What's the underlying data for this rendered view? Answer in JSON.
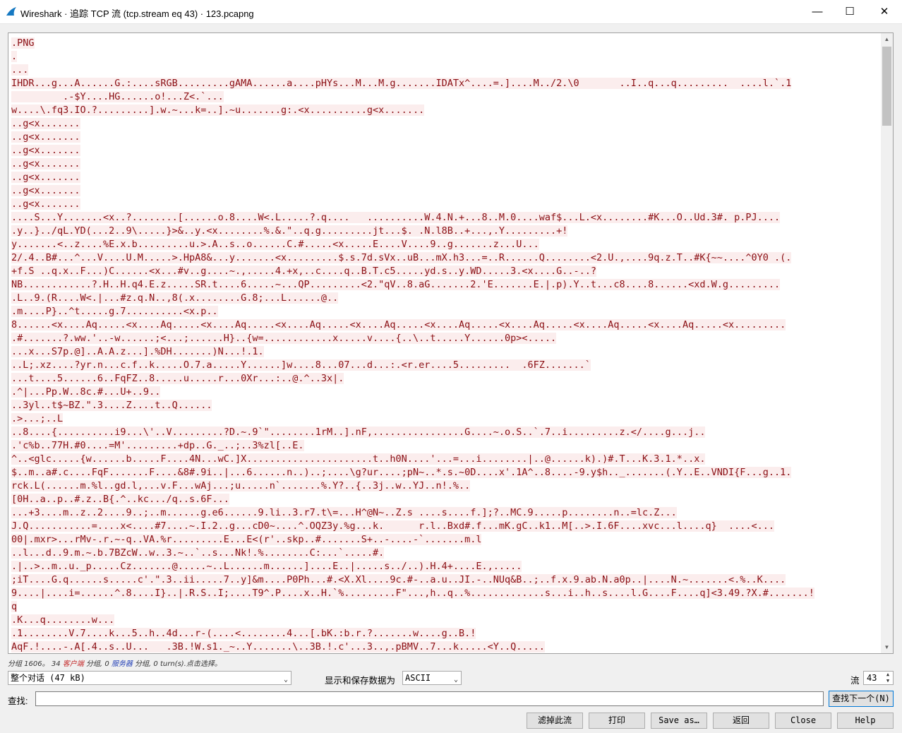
{
  "window": {
    "title": "Wireshark · 追踪 TCP 流 (tcp.stream eq 43) · 123.pcapng",
    "minimize_glyph": "—",
    "maximize_glyph": "☐",
    "close_glyph": "✕"
  },
  "stream": {
    "text_color": "#8b0f14",
    "highlight_color": "#fbeded",
    "lines": [
      ".PNG",
      ".",
      "...",
      "IHDR...g...A......G.:....sRGB.........gAMA......a....pHYs...M...M.g.......IDATx^....=.]....M../2.\\0       ..I..q...q.........  ....l.`.1",
      "         .-$Y....HG......o!...Z<.`...",
      "w....\\.fq3.IO.?.........].w.~...k=..].~u.......g:.<x..........g<x.......",
      "..g<x.......",
      "..g<x.......",
      "..g<x.......",
      "..g<x.......",
      "..g<x.......",
      "..g<x.......",
      "..g<x.......",
      "....S...Y.......<x..?........[......o.8....W<.L.....?.q....   ..........W.4.N.+...8..M.0....waf$...L.<x........#K...O..Ud.3#. p.PJ....",
      ".y..}../qL.YD(...2..9\\.....}>&..y.<x........%.&.\"..q.g.........jt...$. .N.l8B..+...,.Y.........+!",
      "y.......<..z....%E.x.b.........u.>.A..s..o......C.#.....<x.....E....V....9..g.......z...U...",
      "2/.4..B#...^...V....U.M.....>.HpA8&...y.......<x.........$.s.7d.sVx..uB...mX.h3...=..R......Q........<2.U.,....9q.z.T..#K{~~....^0Y0 .(.",
      "+f.S ..q.x..F...)C......<x...#v..g....~.,.....4.+x,..c....q..B.T.c5.....yd.s..y.WD.....3.<x....G..-..?",
      "NB............?.H..H.q4.E.z.....SR.t....6.....~...QP.........<2.\"qV..8.aG.......2.'E.......E.|.p).Y..t...c8....8......<xd.W.g.........",
      ".L..9.(R....W<.|...#z.q.N..,8(.x........G.8;...L......@..",
      ".m....P}..^t.....g.7..........<x.p..",
      "8......<x....Aq.....<x....Aq.....<x....Aq.....<x....Aq.....<x....Aq.....<x....Aq.....<x....Aq.....<x....Aq.....<x....Aq.....<x.........",
      ".#.......?.ww.'..-w......;<...;......H}..{w=............x.....v....{..\\..t.....Y......0p><.....",
      "...x...S7p.@]..A.A.z...].%DH.......)N...!.1.",
      "..L;.xz....?yr.n...c.f..k.....O.7.a.....Y......]w....8...07...d...:.<r.er....5.........  .6FZ.......`",
      "...t....5......6..FqFZ..8.....u.....r...0Xr...:..@.^..3x|.",
      ".^|...Pp.W..8c.#...U+..9..",
      "..3yl..t$~BZ.\".3....Z....t..Q......",
      ".>...;..L",
      "..8....{..........i9...\\'..V.........?D.~.9`\"........1rM..].nF,................G....~.o.S..`.7..i.........z.</....g...j..",
      ".'c%b..77H.#0....=M'.........+dp..G._..;..3%zl[..E.",
      "^..<glc.....{w......b.....F....4N...wC.]X......................t..h0N....'...=...i........|..@......k).)#.T...K.3.1.*..x.",
      "$..m..a#.c....FqF.......F....&8#.9i..|...6......n..)..;....\\g?ur....;pN~..*.s.~0D....x'.1A^..8....-9.y$h.._.......(.Y..E..VNDI{F...g..1.",
      "rck.L(......m.%l..gd.l,...v.F...wAj...;u.....n`.......%.Y?..{..3j..w..YJ..n!.%..",
      "[0H..a..p..#.z..B{.^..kc.../q..s.6F...",
      "...+3....m..z..2....9..;..m......g.e6......9.li..3.r7.t\\=...H^@N~..Z.s ....s....f.];?..MC.9.....p........n..=lc.Z...",
      "J.Q...........=....x<....#7....~.I.2..g...cD0~....^.OQZ3y.%g...k.      r.l..Bxd#.f...mK.gC..k1..M[..>.I.6F....xvc...l....q}  ....<...",
      "00|.mxr>...rMv-.r.~-q..VA.%r.........E...E<(r'..skp..#.......S+..-....-`.......m.l",
      "..l...d..9.m.~.b.7BZcW..w..3.~..`..s...Nk!.%........C:...`.....#.",
      ".|..>..m..u._p.....Cz.......@.....~..L......m......]....E..|.....s../..).H.4+....E.,.....",
      ";iT....G.q......s.....c'.\".3..ii.....7..y]&m....P0Ph...#.<X.Xl....9c.#-..a.u..JI.-..NUq&B..;..f.x.9.ab.N.a0p..|....N.~.......<.%..K....",
      "9....|....i=......^.8....I}..|.R.S..I;....T9^.P....x..H.`%.........F\"...,h..q..%.............s...i..h..s....l.G....F....q]<3.49.?X.#.......!",
      "q",
      ".K...q........w...",
      ".1........V.7....k...5..h..4d...r-(....<........4...[.bK.:b.r.?.......w....g..B.!",
      "AqF.!....-.A[.4..s..U...   .3B.!W.s1._~..Y.......\\..3B.!.c'...3..,.pBMV..7...k.....<Y..Q....."
    ]
  },
  "status": {
    "prefix": "分组 1606。",
    "client_count": "34",
    "client_label": "客户端",
    "middle": "分组,",
    "server_count": "0",
    "server_label": "服务器",
    "suffix": "分组, 0 turn(s).点击选择。"
  },
  "controls": {
    "conversation_select": "整个对话 (47 kB)",
    "format_label": "显示和保存数据为",
    "format_select": "ASCII",
    "stream_label": "流",
    "stream_value": "43"
  },
  "find": {
    "label": "查找:",
    "value": "",
    "find_next_button": "查找下一个(N)"
  },
  "buttons": {
    "filter_out": "滤掉此流",
    "print": "打印",
    "save_as": "Save as…",
    "back": "返回",
    "close": "Close",
    "help": "Help"
  }
}
